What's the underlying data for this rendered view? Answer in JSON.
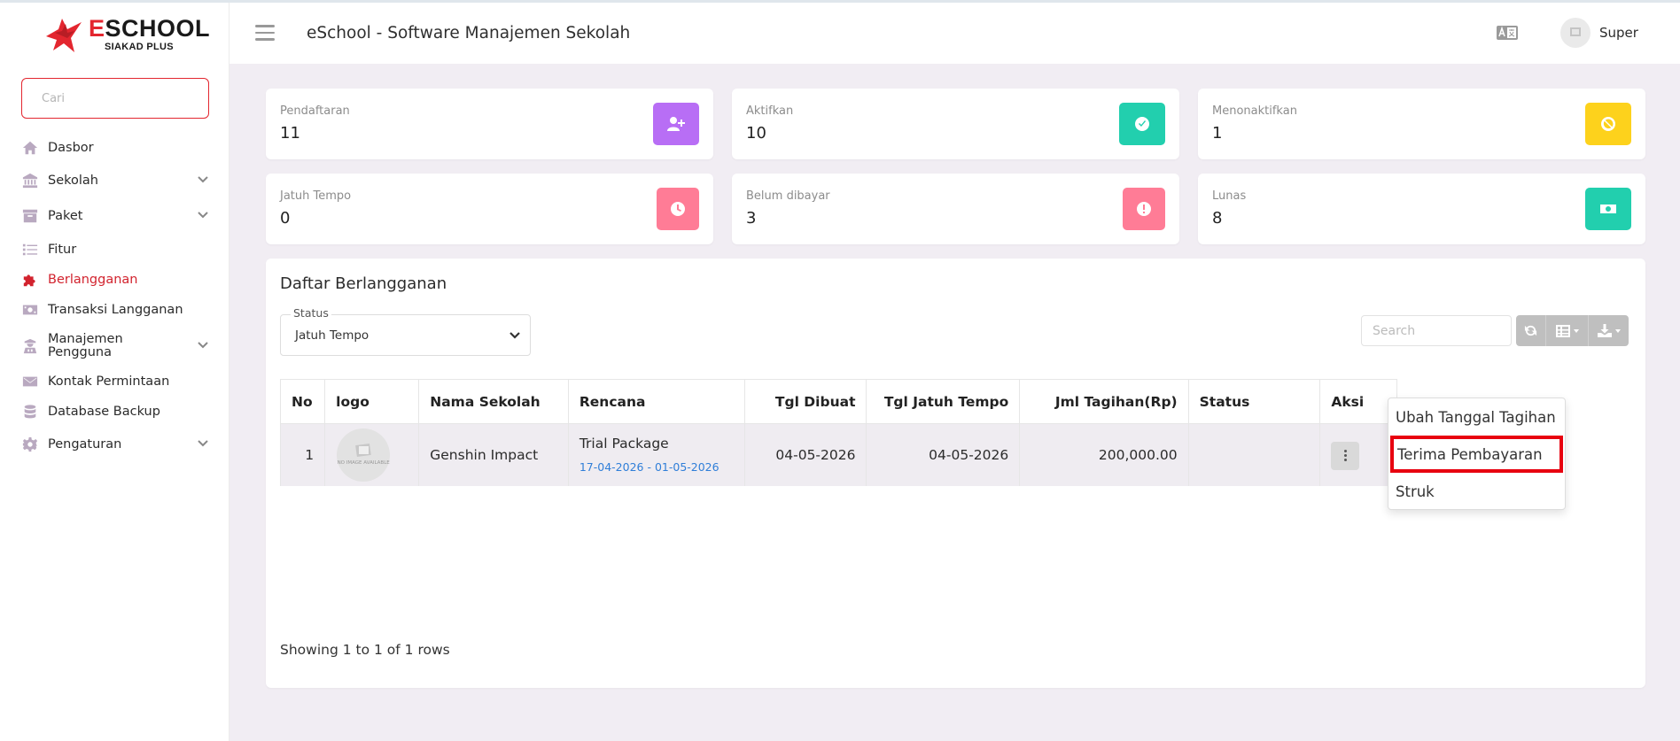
{
  "brand": {
    "name_first": "E",
    "name_rest": "SCHOOL",
    "sub": "SIAKAD PLUS"
  },
  "sidebar": {
    "search_placeholder": "Cari",
    "items": [
      {
        "label": "Dasbor",
        "icon": "home-icon"
      },
      {
        "label": "Sekolah",
        "icon": "bank-icon"
      },
      {
        "label": "Paket",
        "icon": "box-icon"
      },
      {
        "label": "Fitur",
        "icon": "list-icon"
      },
      {
        "label": "Berlangganan",
        "icon": "puzzle-icon"
      },
      {
        "label": "Transaksi Langganan",
        "icon": "money-icon"
      },
      {
        "label": "Manajemen Pengguna",
        "icon": "user-group-icon"
      },
      {
        "label": "Kontak Permintaan",
        "icon": "envelope-icon"
      },
      {
        "label": "Database Backup",
        "icon": "database-icon"
      },
      {
        "label": "Pengaturan",
        "icon": "gear-icon"
      }
    ],
    "active": "Berlangganan"
  },
  "header": {
    "title": "eSchool - Software Manajemen Sekolah",
    "user": "Super"
  },
  "stats": [
    {
      "label": "Pendaftaran",
      "value": "11",
      "color": "#b86ef5",
      "icon": "user-plus-icon"
    },
    {
      "label": "Aktifkan",
      "value": "10",
      "color": "#22cfae",
      "icon": "check-circle-icon"
    },
    {
      "label": "Menonaktifkan",
      "value": "1",
      "color": "#fdd21c",
      "icon": "ban-icon"
    },
    {
      "label": "Jatuh Tempo",
      "value": "0",
      "color": "#ff7c96",
      "icon": "clock-icon"
    },
    {
      "label": "Belum dibayar",
      "value": "3",
      "color": "#ff7c96",
      "icon": "exclamation-circle-icon"
    },
    {
      "label": "Lunas",
      "value": "8",
      "color": "#22cfae",
      "icon": "cash-icon"
    }
  ],
  "list": {
    "title": "Daftar Berlangganan",
    "status_label": "Status",
    "status_value": "Jatuh Tempo",
    "search_placeholder": "Search",
    "columns": [
      "No",
      "logo",
      "Nama Sekolah",
      "Rencana",
      "Tgl Dibuat",
      "Tgl Jatuh Tempo",
      "Jml Tagihan(Rp)",
      "Status",
      "Aksi"
    ],
    "rows": [
      {
        "no": "1",
        "logo_text": "NO IMAGE AVAILABLE",
        "school": "Genshin Impact",
        "plan": "Trial Package",
        "plan_range": "17-04-2026 - 01-05-2026",
        "created": "04-05-2026",
        "due": "04-05-2026",
        "amount": "200,000.00"
      }
    ],
    "rows_info": "Showing 1 to 1 of 1 rows"
  },
  "dropdown": {
    "items": [
      "Ubah Tanggal Tagihan",
      "Terima Pembayaran",
      "Struk"
    ],
    "highlighted": "Terima Pembayaran"
  }
}
